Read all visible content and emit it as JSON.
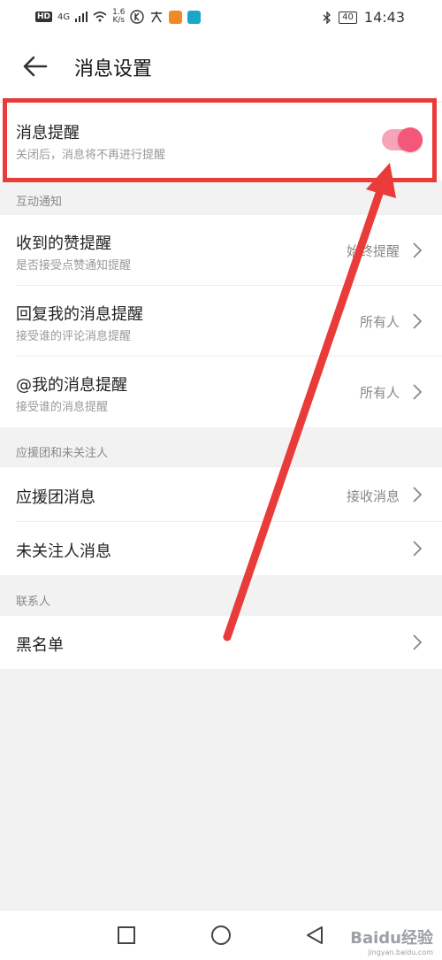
{
  "status_bar": {
    "left_badge": "HD",
    "network": "4G",
    "speed_value": "1.6",
    "speed_unit": "K/s",
    "battery": "40",
    "time": "14:43"
  },
  "header": {
    "title": "消息设置"
  },
  "master": {
    "title": "消息提醒",
    "subtitle": "关闭后，消息将不再进行提醒",
    "enabled": true
  },
  "sections": [
    {
      "label": "互动通知",
      "items": [
        {
          "title": "收到的赞提醒",
          "subtitle": "是否接受点赞通知提醒",
          "value": "始终提醒"
        },
        {
          "title": "回复我的消息提醒",
          "subtitle": "接受谁的评论消息提醒",
          "value": "所有人"
        },
        {
          "title": "@我的消息提醒",
          "subtitle": "接受谁的消息提醒",
          "value": "所有人"
        }
      ]
    },
    {
      "label": "应援团和未关注人",
      "items": [
        {
          "title": "应援团消息",
          "value": "接收消息"
        },
        {
          "title": "未关注人消息",
          "value": ""
        }
      ]
    },
    {
      "label": "联系人",
      "items": [
        {
          "title": "黑名单",
          "value": ""
        }
      ]
    }
  ],
  "watermark": {
    "brand": "Baidu经验",
    "url": "jingyan.baidu.com"
  },
  "colors": {
    "accent": "#f5577a",
    "annotation": "#e93b39"
  }
}
